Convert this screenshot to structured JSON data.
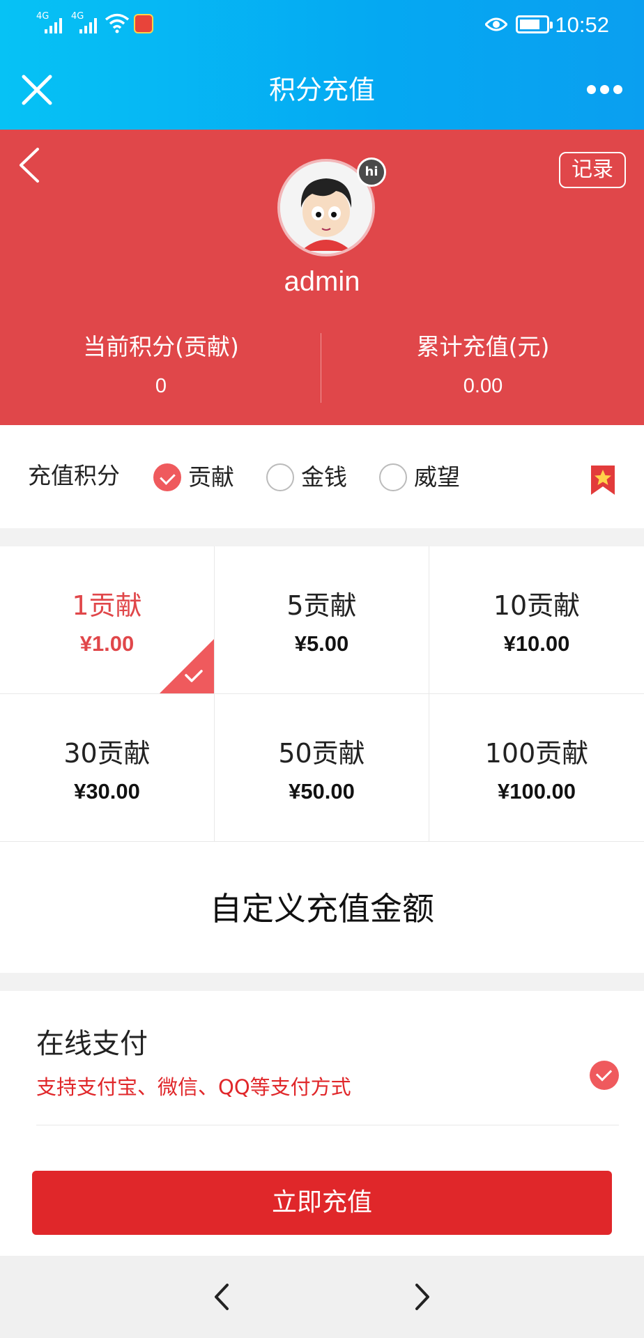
{
  "status_bar": {
    "time": "10:52",
    "signal_1_label": "4G",
    "signal_2_label": "4G",
    "icons": [
      "signal-icon",
      "signal-icon",
      "wifi-icon",
      "app-notification-icon",
      "eye-icon",
      "battery-icon"
    ]
  },
  "title_bar": {
    "title": "积分充值",
    "left_icon": "close-icon",
    "right_icon": "more-icon"
  },
  "profile": {
    "record_label": "记录",
    "badge": "hi",
    "username": "admin",
    "stats": [
      {
        "label": "当前积分(贡献)",
        "value": "0"
      },
      {
        "label": "累计充值(元)",
        "value": "0.00"
      }
    ]
  },
  "recharge_type": {
    "label": "充值积分",
    "options": [
      {
        "label": "贡献",
        "selected": true
      },
      {
        "label": "金钱",
        "selected": false
      },
      {
        "label": "威望",
        "selected": false
      }
    ]
  },
  "packages": [
    {
      "name": "1贡献",
      "price": "¥1.00",
      "selected": true
    },
    {
      "name": "5贡献",
      "price": "¥5.00",
      "selected": false
    },
    {
      "name": "10贡献",
      "price": "¥10.00",
      "selected": false
    },
    {
      "name": "30贡献",
      "price": "¥30.00",
      "selected": false
    },
    {
      "name": "50贡献",
      "price": "¥50.00",
      "selected": false
    },
    {
      "name": "100贡献",
      "price": "¥100.00",
      "selected": false
    }
  ],
  "custom_amount_label": "自定义充值金额",
  "payment": {
    "title": "在线支付",
    "description": "支持支付宝、微信、QQ等支付方式",
    "selected": true
  },
  "submit_label": "立即充值",
  "colors": {
    "title_bar": "#05a8f2",
    "header_red": "#e0474a",
    "button_red": "#e0272a",
    "accent_check": "#ef5a5d"
  }
}
